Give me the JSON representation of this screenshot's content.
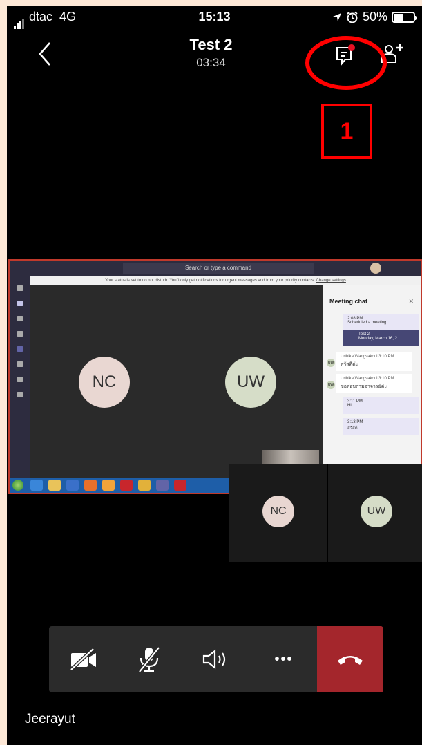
{
  "status_bar": {
    "carrier": "dtac",
    "network": "4G",
    "time": "15:13",
    "battery": "50%",
    "battery_level": 0.5
  },
  "header": {
    "meeting_title": "Test 2",
    "duration": "03:34"
  },
  "annotation": {
    "label": "1",
    "color": "#ff0000"
  },
  "shared_screen": {
    "search_placeholder": "Search or type a command",
    "notice": "Your status is set to do not disturb. You'll only get notifications for urgent messages and from your priority contacts.",
    "notice_link": "Change settings",
    "participants": [
      {
        "initials": "NC",
        "color": "#e9d7d2"
      },
      {
        "initials": "UW",
        "color": "#d6ddc8"
      }
    ],
    "chat": {
      "title": "Meeting chat",
      "scheduled_time": "2:08 PM",
      "scheduled_text": "Scheduled a meeting",
      "meeting_name": "Test 2",
      "meeting_date": "Monday, March 16, 2...",
      "messages": [
        {
          "sender": "Urthika Wangsakoul",
          "time": "3:10 PM",
          "text": "สวัสดีค่ะ",
          "initials": "UW"
        },
        {
          "sender": "Urthika Wangsakoul",
          "time": "3:10 PM",
          "text": "ขอสอบถามอาจารย์ค่ะ",
          "initials": "UW"
        }
      ],
      "own_messages": [
        {
          "time": "3:11 PM",
          "text": "Hi"
        },
        {
          "time": "3:13 PM",
          "text": "สวัสดี"
        }
      ]
    }
  },
  "tiles": [
    {
      "initials": "NC",
      "color": "#e8d6d1"
    },
    {
      "initials": "UW",
      "color": "#d5dcc7"
    }
  ],
  "controls": {
    "camera_icon": "camera-off-icon",
    "mic_icon": "mic-off-icon",
    "speaker_icon": "speaker-icon",
    "more_label": "•••",
    "hangup_icon": "hangup-icon",
    "hangup_color": "#a4262c"
  },
  "user": {
    "name": "Jeerayut"
  }
}
